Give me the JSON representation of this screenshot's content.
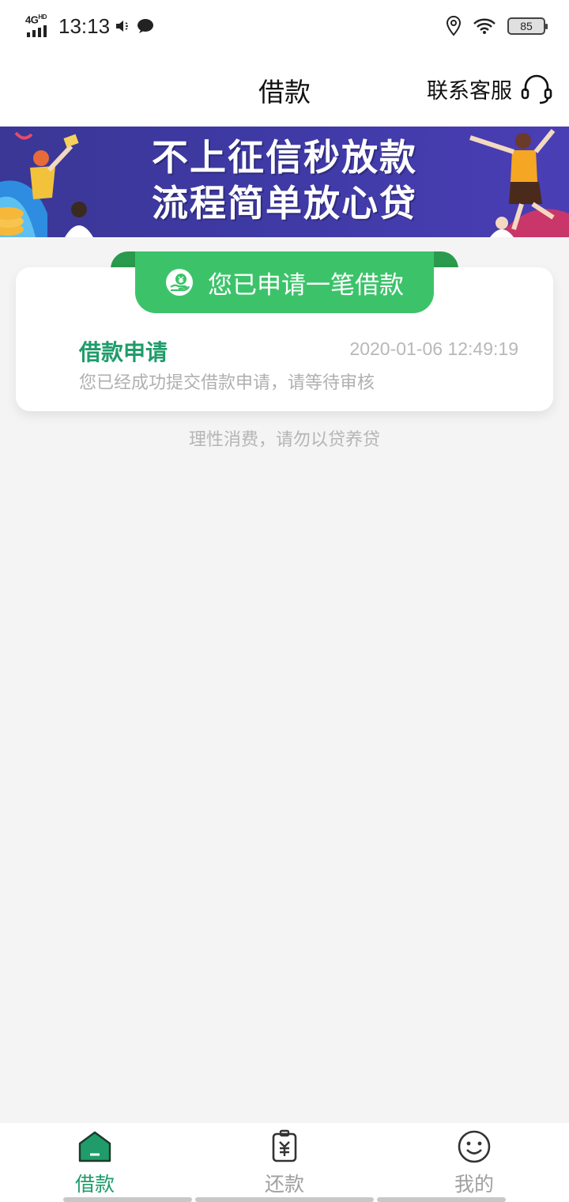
{
  "status_bar": {
    "network": "4G",
    "network_sub": "HD",
    "time": "13:13",
    "battery": "85"
  },
  "header": {
    "title": "借款",
    "contact_label": "联系客服"
  },
  "banner": {
    "line1": "不上征信秒放款",
    "line2": "流程简单放心贷"
  },
  "status_card": {
    "pill_label": "您已申请一笔借款",
    "item_title": "借款申请",
    "item_time": "2020-01-06 12:49:19",
    "item_desc": "您已经成功提交借款申请，请等待审核"
  },
  "tip": "理性消费，请勿以贷养贷",
  "bottom_nav": {
    "items": [
      {
        "label": "借款",
        "icon": "home-icon",
        "active": true
      },
      {
        "label": "还款",
        "icon": "repay-icon",
        "active": false
      },
      {
        "label": "我的",
        "icon": "smile-icon",
        "active": false
      }
    ]
  },
  "colors": {
    "accent_green": "#1f9c6a",
    "pill_green": "#3cc36a",
    "banner_purple": "#3f3aa6"
  }
}
